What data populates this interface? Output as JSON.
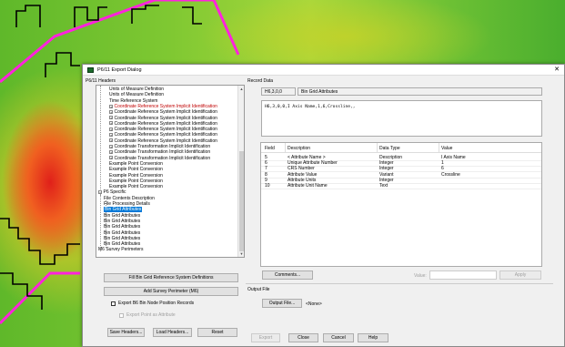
{
  "window": {
    "title": "P6/11 Export Dialog",
    "close_glyph": "✕"
  },
  "headers_group": {
    "label": "P6/11 Headers"
  },
  "tree": {
    "items": [
      {
        "label": "Units of Measure Definition",
        "indent": 2,
        "expander": false,
        "style": "normal"
      },
      {
        "label": "Units of Measure Definition",
        "indent": 2,
        "expander": false,
        "style": "normal"
      },
      {
        "label": "Time Reference System",
        "indent": 2,
        "expander": false,
        "style": "normal"
      },
      {
        "label": "Coordinate Reference System Implicit Identification",
        "indent": 2,
        "expander": true,
        "style": "red"
      },
      {
        "label": "Coordinate Reference System Implicit Identification",
        "indent": 2,
        "expander": true,
        "style": "normal"
      },
      {
        "label": "Coordinate Reference System Implicit Identification",
        "indent": 2,
        "expander": true,
        "style": "normal"
      },
      {
        "label": "Coordinate Reference System Implicit Identification",
        "indent": 2,
        "expander": true,
        "style": "normal"
      },
      {
        "label": "Coordinate Reference System Implicit Identification",
        "indent": 2,
        "expander": true,
        "style": "normal"
      },
      {
        "label": "Coordinate Reference System Implicit Identification",
        "indent": 2,
        "expander": true,
        "style": "normal"
      },
      {
        "label": "Coordinate Reference System Implicit Identification",
        "indent": 2,
        "expander": true,
        "style": "normal"
      },
      {
        "label": "Coordinate Transformation Implicit Identification",
        "indent": 2,
        "expander": true,
        "style": "normal"
      },
      {
        "label": "Coordinate Transformation Implicit Identification",
        "indent": 2,
        "expander": true,
        "style": "normal"
      },
      {
        "label": "Coordinate Transformation Implicit Identification",
        "indent": 2,
        "expander": true,
        "style": "normal"
      },
      {
        "label": "Example Point Conversion",
        "indent": 2,
        "expander": false,
        "style": "normal"
      },
      {
        "label": "Example Point Conversion",
        "indent": 2,
        "expander": false,
        "style": "normal"
      },
      {
        "label": "Example Point Conversion",
        "indent": 2,
        "expander": false,
        "style": "normal"
      },
      {
        "label": "Example Point Conversion",
        "indent": 2,
        "expander": false,
        "style": "normal"
      },
      {
        "label": "Example Point Conversion",
        "indent": 2,
        "expander": false,
        "style": "normal"
      },
      {
        "label": "P6 Specific",
        "indent": 0,
        "expander": true,
        "style": "normal"
      },
      {
        "label": "File Contents Description",
        "indent": 1,
        "expander": false,
        "style": "normal"
      },
      {
        "label": "File Processing Details",
        "indent": 1,
        "expander": false,
        "style": "normal"
      },
      {
        "label": "Bin Grid Attributes",
        "indent": 1,
        "expander": false,
        "style": "selected"
      },
      {
        "label": "Bin Grid Attributes",
        "indent": 1,
        "expander": false,
        "style": "normal"
      },
      {
        "label": "Bin Grid Attributes",
        "indent": 1,
        "expander": false,
        "style": "normal"
      },
      {
        "label": "Bin Grid Attributes",
        "indent": 1,
        "expander": false,
        "style": "normal"
      },
      {
        "label": "Bin Grid Attributes",
        "indent": 1,
        "expander": false,
        "style": "normal"
      },
      {
        "label": "Bin Grid Attributes",
        "indent": 1,
        "expander": false,
        "style": "normal"
      },
      {
        "label": "Bin Grid Attributes",
        "indent": 1,
        "expander": false,
        "style": "normal"
      },
      {
        "label": "M6 Survey Perimeters",
        "indent": 0,
        "expander": false,
        "style": "normal"
      }
    ],
    "expand_glyph": "+",
    "collapse_glyph": "−",
    "scroll_up_glyph": "▲",
    "scroll_down_glyph": "▼"
  },
  "buttons": {
    "fill_bin_grid": "Fill Bin Grid Reference System Definitions",
    "add_survey_perimeter": "Add Survey Perimeter (M6)",
    "save_headers": "Save Headers...",
    "load_headers": "Load Headers...",
    "reset": "Reset",
    "comments": "Comments...",
    "apply": "Apply",
    "output_file": "Output File...",
    "export": "Export",
    "close": "Close",
    "cancel": "Cancel",
    "help": "Help"
  },
  "checkboxes": {
    "export_b6": "Export B6 Bin Node Position Records",
    "export_point": "Export Point as Attribute"
  },
  "record_data": {
    "label": "Record Data",
    "code": "H6,3,0,0",
    "name": "Bin Grid Attributes",
    "record_text": "H6,3,0,0,I Axis Name,1,6,Crossline,,"
  },
  "table": {
    "columns": [
      "Field",
      "Description",
      "Data Type",
      "Value"
    ],
    "rows": [
      [
        "5",
        "< Attribute Name >",
        "Description",
        "I Axis Name"
      ],
      [
        "6",
        "Unique Attribute Number",
        "Integer",
        "1"
      ],
      [
        "7",
        "CRS Number",
        "Integer",
        "6"
      ],
      [
        "8",
        "Attribute Value",
        "Variant",
        "Crossline"
      ],
      [
        "9",
        "Attribute Units",
        "Integer",
        ""
      ],
      [
        "10",
        "Attribute Unit Name",
        "Text",
        ""
      ]
    ]
  },
  "value_label": "Value:",
  "output": {
    "label": "Output File",
    "value": "<None>"
  }
}
